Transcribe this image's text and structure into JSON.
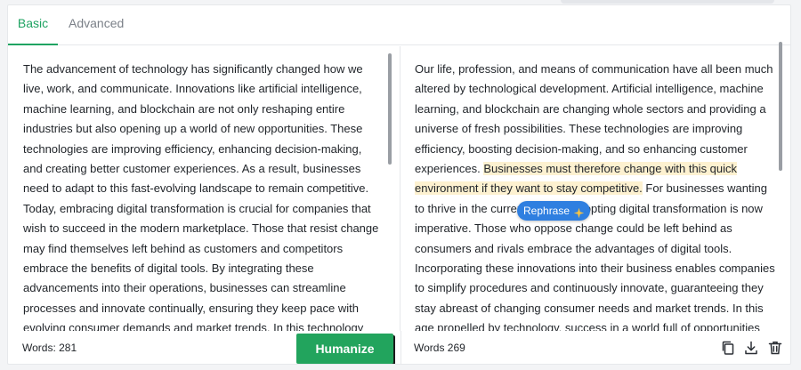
{
  "tabs": {
    "basic": "Basic",
    "advanced": "Advanced"
  },
  "left": {
    "text": "The advancement of technology has significantly changed how we live, work, and communicate. Innovations like artificial intelligence, machine learning, and blockchain are not only reshaping entire industries but also opening up a world of new opportunities. These technologies are improving efficiency, enhancing decision-making, and creating better customer experiences. As a result, businesses need to adapt to this fast-evolving landscape to remain competitive. Today, embracing digital transformation is crucial for companies that wish to succeed in the modern marketplace. Those that resist change may find themselves left behind as customers and competitors embrace the benefits of digital tools. By integrating these advancements into their operations, businesses can streamline processes and innovate continually, ensuring they keep pace with evolving consumer demands and market trends. In this technology",
    "word_count": "Words: 281"
  },
  "right": {
    "text_before": "Our life, profession, and means of communication have all been much altered by technological development. Artificial intelligence, machine learning, and blockchain are changing whole sectors and providing a universe of fresh possibilities. These technologies are improving efficiency, boosting decision-making, and so enhancing customer experiences. ",
    "text_highlight": "Businesses must therefore change with this quick environment if they want to stay competitive.",
    "text_after": " For businesses wanting to thrive in the current market, adopting digital transformation is now imperative. Those who oppose change could be left behind as consumers and rivals embrace the advantages of digital tools. Incorporating these innovations into their business enables companies to simplify procedures and continuously innovate, guaranteeing they stay abreast of changing consumer needs and market trends. In this age propelled by technology, success in a world full of opportunities",
    "word_count": "Words 269"
  },
  "rephrase_label": "Rephrase",
  "humanize_label": "Humanize",
  "icons": [
    "copy-icon",
    "download-icon",
    "trash-icon",
    "sparkle-icon"
  ],
  "colors": {
    "accent": "#1fa362",
    "button": "#22a45d",
    "rephrase": "#2f7fe0",
    "highlight": "#fdf1d0"
  }
}
